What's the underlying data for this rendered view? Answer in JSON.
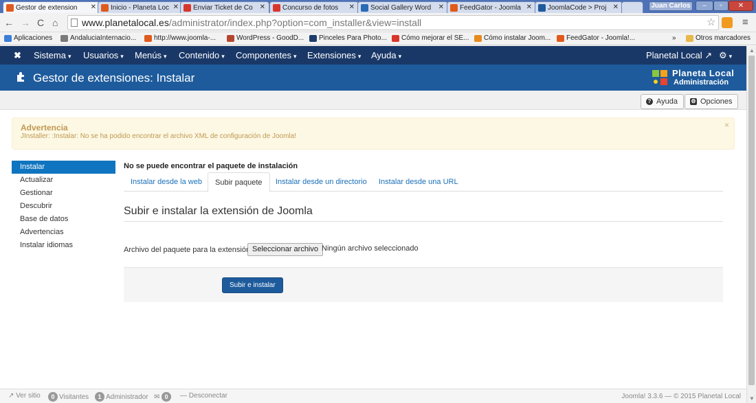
{
  "browser": {
    "tabs": [
      {
        "label": "Gestor de extension",
        "active": true,
        "color": "#e05a1c"
      },
      {
        "label": "Inicio - Planeta Loc",
        "active": false,
        "color": "#e05a1c"
      },
      {
        "label": "Enviar Ticket de Co",
        "active": false,
        "color": "#d9362b"
      },
      {
        "label": "Concurso de fotos",
        "active": false,
        "color": "#d9362b"
      },
      {
        "label": "Social Gallery Word",
        "active": false,
        "color": "#2a6bb5"
      },
      {
        "label": "FeedGator - Joomla",
        "active": false,
        "color": "#e05a1c"
      },
      {
        "label": "JoomlaCode > Proj",
        "active": false,
        "color": "#1e5b9c"
      }
    ],
    "user": "Juan Carlos",
    "url_host": "www.planetalocal.es",
    "url_path": "/administrator/index.php?option=com_installer&view=install",
    "bookmarks": [
      {
        "label": "Aplicaciones",
        "color": "#3b7dd8"
      },
      {
        "label": "AndaluciaInternacio...",
        "color": "#7a7a7a"
      },
      {
        "label": "http://www.joomla-...",
        "color": "#e05a1c"
      },
      {
        "label": "WordPress - GoodD...",
        "color": "#b5462e"
      },
      {
        "label": "Pinceles Para Photo...",
        "color": "#1e3d6b"
      },
      {
        "label": "Cómo mejorar el SE...",
        "color": "#d9362b"
      },
      {
        "label": "Cómo instalar Joom...",
        "color": "#e68a1c"
      },
      {
        "label": "FeedGator - Joomla!...",
        "color": "#e05a1c"
      }
    ],
    "bookmarks_more": "»",
    "other_bookmarks": "Otros marcadores"
  },
  "jnav": {
    "items": [
      "Sistema",
      "Usuarios",
      "Menús",
      "Contenido",
      "Componentes",
      "Extensiones",
      "Ayuda"
    ],
    "site_name": "Planetal Local",
    "settings_icon": "gear-icon"
  },
  "header": {
    "title": "Gestor de extensiones: Instalar",
    "logo_line1": "Planeta Local",
    "logo_line2": "Administración"
  },
  "toolbar": {
    "help_label": "Ayuda",
    "options_label": "Opciones"
  },
  "alert": {
    "heading": "Advertencia",
    "message": "JInstaller: :Instalar: No se ha podido encontrar el archivo XML de configuración de Joomla!",
    "close": "×"
  },
  "sidebar": {
    "items": [
      {
        "label": "Instalar",
        "active": true
      },
      {
        "label": "Actualizar",
        "active": false
      },
      {
        "label": "Gestionar",
        "active": false
      },
      {
        "label": "Descubrir",
        "active": false
      },
      {
        "label": "Base de datos",
        "active": false
      },
      {
        "label": "Advertencias",
        "active": false
      },
      {
        "label": "Instalar idiomas",
        "active": false
      }
    ]
  },
  "main": {
    "notice": "No se puede encontrar el paquete de instalación",
    "tabs": [
      {
        "label": "Instalar desde la web",
        "active": false
      },
      {
        "label": "Subir paquete",
        "active": true
      },
      {
        "label": "Instalar desde un directorio",
        "active": false
      },
      {
        "label": "Instalar desde una URL",
        "active": false
      }
    ],
    "heading": "Subir e instalar la extensión de Joomla",
    "file_label": "Archivo del paquete para la extensión",
    "file_button": "Seleccionar archivo",
    "file_status": "Ningún archivo seleccionado",
    "submit_label": "Subir e instalar"
  },
  "status": {
    "view_site": "Ver sitio",
    "visitors_count": "0",
    "visitors_label": "Visitantes",
    "admins_count": "1",
    "admins_label": "Administrador",
    "messages_count": "0",
    "logout": "Desconectar",
    "version": "Joomla! 3.3.6 — © 2015 Planetal Local"
  },
  "colors": {
    "navbar": "#1a3867",
    "header": "#1e5b9c",
    "active_sidebar": "#0f75c0",
    "warning_text": "#c09853"
  }
}
